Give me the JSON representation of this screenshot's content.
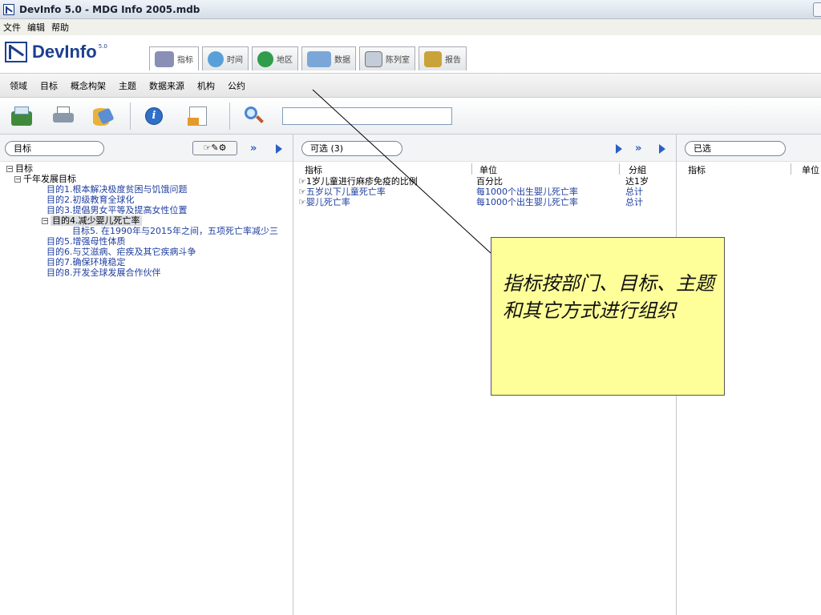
{
  "window": {
    "title": "DevInfo 5.0 - MDG Info 2005.mdb"
  },
  "menu": {
    "items": [
      "文件",
      "编辑",
      "帮助"
    ]
  },
  "logo": {
    "text": "DevInfo",
    "version": "5.0"
  },
  "tabs": [
    {
      "label": "指标",
      "icon": "indicator-icon",
      "color": "#8a8fb5"
    },
    {
      "label": "时间",
      "icon": "clock-icon",
      "color": "#5aa0d8"
    },
    {
      "label": "地区",
      "icon": "globe-icon",
      "color": "#2f9d49"
    },
    {
      "label": "数据",
      "icon": "data-icon",
      "color": "#7aa7d8"
    },
    {
      "label": "陈列室",
      "icon": "gallery-icon",
      "color": "#c3ccd8"
    },
    {
      "label": "报告",
      "icon": "report-icon",
      "color": "#c9a33a"
    }
  ],
  "submenu": {
    "items": [
      "领域",
      "目标",
      "概念构架",
      "主题",
      "数据来源",
      "机构",
      "公约"
    ]
  },
  "left_panel": {
    "title": "目标",
    "tree": [
      {
        "label": "目标",
        "level": 0,
        "expander": "−"
      },
      {
        "label": "千年发展目标",
        "level": 1,
        "expander": "−"
      },
      {
        "label": "目的1.根本解决极度贫困与饥饿问题",
        "level": 2
      },
      {
        "label": "目的2.初级教育全球化",
        "level": 2
      },
      {
        "label": "目的3.提倡男女平等及提高女性位置",
        "level": 2
      },
      {
        "label": "目的4.减少婴儿死亡率",
        "level": 2,
        "selected": true,
        "expander": "−"
      },
      {
        "label": "目标5. 在1990年与2015年之间，五项死亡率减少三",
        "level": 3
      },
      {
        "label": "目的5.增强母性体质",
        "level": 2
      },
      {
        "label": "目的6.与艾滋病、疟疾及其它疾病斗争",
        "level": 2
      },
      {
        "label": "目的7.确保环境稳定",
        "level": 2
      },
      {
        "label": "目的8.开发全球发展合作伙伴",
        "level": 2
      }
    ]
  },
  "mid_panel": {
    "title": "可选 (3)",
    "columns": [
      "指标",
      "单位",
      "分組"
    ],
    "rows": [
      {
        "indicator": "1岁儿童进行麻疹免疫的比例",
        "unit": "百分比",
        "group": "达1岁"
      },
      {
        "indicator": "五岁以下儿童死亡率",
        "unit": "每1000个出生婴儿死亡率",
        "group": "总计"
      },
      {
        "indicator": "婴儿死亡率",
        "unit": "每1000个出生婴儿死亡率",
        "group": "总计"
      }
    ]
  },
  "right_panel": {
    "title": "已选",
    "columns": [
      "指标",
      "单位"
    ]
  },
  "callout": {
    "text": "指标按部门、目标、主题和其它方式进行组织"
  }
}
